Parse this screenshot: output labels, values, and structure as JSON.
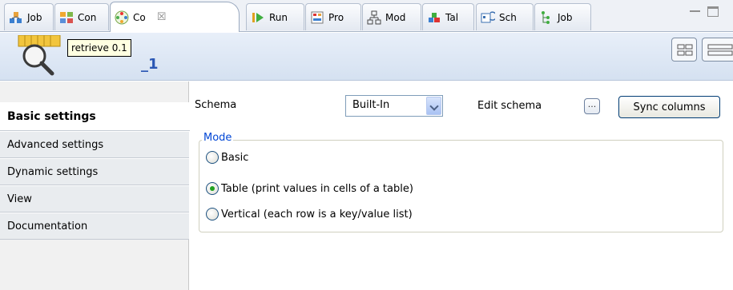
{
  "tabs": [
    {
      "label": "Job",
      "icon": "job-icon",
      "active": false
    },
    {
      "label": "Con",
      "icon": "contexts-icon",
      "active": false
    },
    {
      "label": "Co",
      "icon": "component-icon",
      "active": true
    },
    {
      "label": "Run",
      "icon": "run-icon",
      "active": false
    },
    {
      "label": "Pro",
      "icon": "problems-icon",
      "active": false
    },
    {
      "label": "Mod",
      "icon": "modules-icon",
      "active": false
    },
    {
      "label": "Tal",
      "icon": "talend-icon",
      "active": false
    },
    {
      "label": "Sch",
      "icon": "scheduler-icon",
      "active": false
    },
    {
      "label": "Job",
      "icon": "job-hierarchy-icon",
      "active": false
    }
  ],
  "tab_close_glyph": "☒",
  "window_controls": [
    "minimize",
    "maximize"
  ],
  "title": {
    "tooltip": "retrieve 0.1",
    "name_fragment": "_1",
    "component_icon": "log-row-magnifier-icon"
  },
  "sidebar": {
    "items": [
      {
        "label": "Basic settings",
        "active": true
      },
      {
        "label": "Advanced settings",
        "active": false
      },
      {
        "label": "Dynamic settings",
        "active": false
      },
      {
        "label": "View",
        "active": false
      },
      {
        "label": "Documentation",
        "active": false
      }
    ]
  },
  "schema": {
    "label": "Schema",
    "value": "Built-In",
    "edit_label": "Edit schema",
    "dots_label": "...",
    "sync_label": "Sync columns"
  },
  "mode": {
    "legend": "Mode",
    "options": [
      {
        "label": "Basic",
        "checked": false
      },
      {
        "label": "Table (print values in cells of a table)",
        "checked": true
      },
      {
        "label": "Vertical (each row is a key/value list)",
        "checked": false
      }
    ]
  },
  "colors": {
    "accent": "#2b57b4",
    "legend": "#0046d5",
    "radio_checked": "#21a121"
  }
}
